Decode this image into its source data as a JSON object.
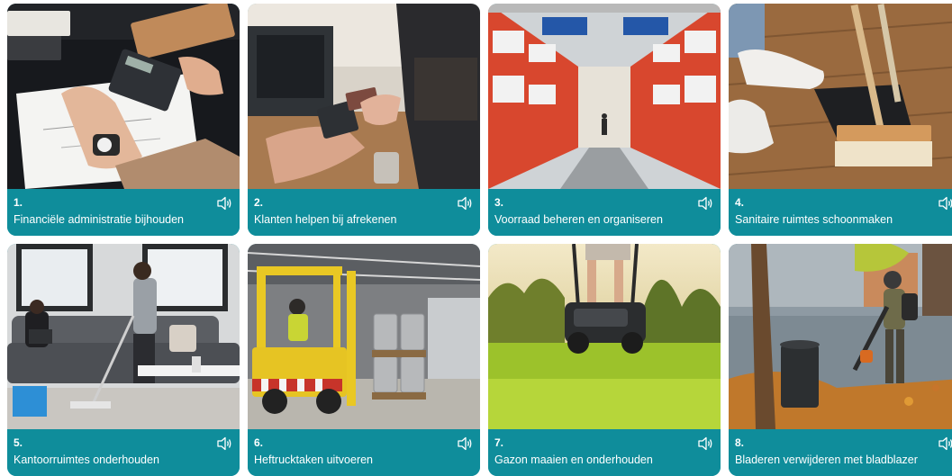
{
  "cards": [
    {
      "number": "1.",
      "label": "Financiële administratie bijhouden",
      "icon": "speaker-icon"
    },
    {
      "number": "2.",
      "label": "Klanten helpen bij afrekenen",
      "icon": "speaker-icon"
    },
    {
      "number": "3.",
      "label": "Voorraad beheren en organiseren",
      "icon": "speaker-icon"
    },
    {
      "number": "4.",
      "label": "Sanitaire ruimtes schoonmaken",
      "icon": "speaker-icon"
    },
    {
      "number": "5.",
      "label": "Kantoorruimtes onderhouden",
      "icon": "speaker-icon"
    },
    {
      "number": "6.",
      "label": "Heftrucktaken uitvoeren",
      "icon": "speaker-icon"
    },
    {
      "number": "7.",
      "label": "Gazon maaien en onderhouden",
      "icon": "speaker-icon"
    },
    {
      "number": "8.",
      "label": "Bladeren verwijderen met bladblazer",
      "icon": "speaker-icon"
    }
  ],
  "colors": {
    "caption_bg": "#0f8d9b",
    "caption_text": "#ffffff"
  }
}
